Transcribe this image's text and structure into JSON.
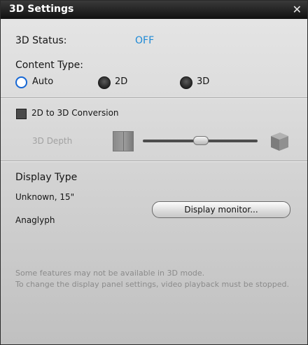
{
  "window": {
    "title": "3D Settings",
    "close_glyph": "✕"
  },
  "status": {
    "label": "3D Status:",
    "value": "OFF",
    "value_color": "#1e8ad6"
  },
  "content_type": {
    "label": "Content Type:",
    "options": [
      {
        "label": "Auto",
        "selected": true
      },
      {
        "label": "2D",
        "selected": false
      },
      {
        "label": "3D",
        "selected": false
      }
    ]
  },
  "conversion": {
    "checkbox_label": "2D to 3D Conversion",
    "checked": false,
    "depth_label": "3D Depth",
    "depth_level_fraction": 0.5
  },
  "display": {
    "heading": "Display Type",
    "type_value": "Unknown, 15\"",
    "mode_value": "Anaglyph",
    "button_label": "Display monitor..."
  },
  "notes": {
    "line1": "Some features may not be available in 3D mode.",
    "line2": "To change the display panel settings, video playback must be stopped."
  }
}
